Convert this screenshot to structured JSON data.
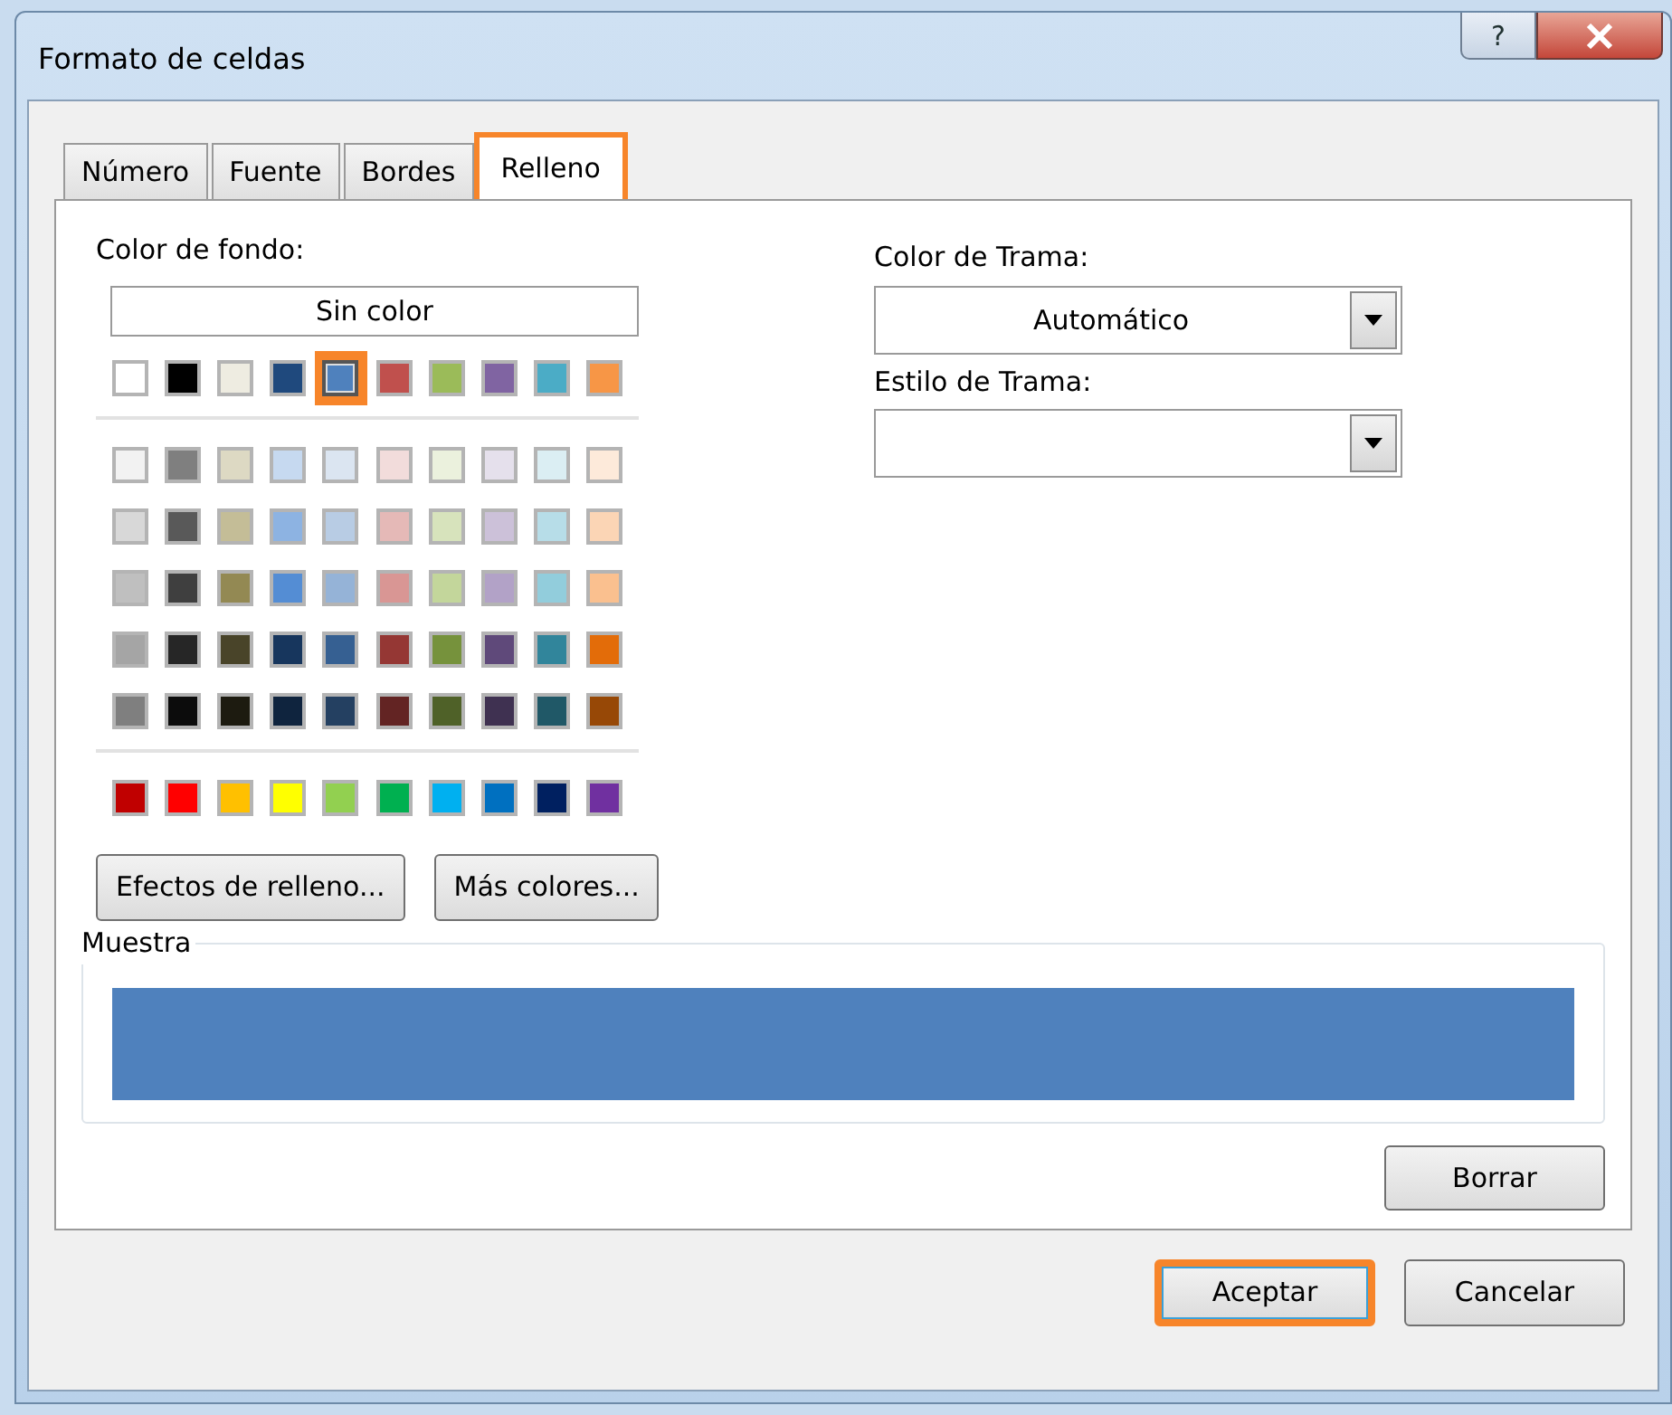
{
  "window": {
    "title": "Formato de celdas",
    "help": "?"
  },
  "tabs": [
    {
      "label": "Número",
      "selected": false
    },
    {
      "label": "Fuente",
      "selected": false
    },
    {
      "label": "Bordes",
      "selected": false
    },
    {
      "label": "Relleno",
      "selected": true,
      "highlighted": true
    }
  ],
  "background_color": {
    "label": "Color de fondo:",
    "no_color_button": "Sin color",
    "palette": [
      {
        "kind": "theme",
        "swatches": [
          {
            "color": "#ffffff",
            "selected": false
          },
          {
            "color": "#000000",
            "selected": false
          },
          {
            "color": "#eeece1",
            "selected": false
          },
          {
            "color": "#1f497d",
            "selected": false
          },
          {
            "color": "#4f81bd",
            "selected": true,
            "highlighted": true
          },
          {
            "color": "#c0504d",
            "selected": false
          },
          {
            "color": "#9bbb59",
            "selected": false
          },
          {
            "color": "#8064a2",
            "selected": false
          },
          {
            "color": "#4bacc6",
            "selected": false
          },
          {
            "color": "#f79646",
            "selected": false
          }
        ]
      },
      {
        "kind": "tint",
        "swatches": [
          {
            "color": "#f2f2f2",
            "selected": false
          },
          {
            "color": "#7f7f7f",
            "selected": false
          },
          {
            "color": "#ddd9c3",
            "selected": false
          },
          {
            "color": "#c6d9f0",
            "selected": false
          },
          {
            "color": "#dbe5f1",
            "selected": false
          },
          {
            "color": "#f2dcdb",
            "selected": false
          },
          {
            "color": "#ebf1dd",
            "selected": false
          },
          {
            "color": "#e5e0ec",
            "selected": false
          },
          {
            "color": "#dbeef3",
            "selected": false
          },
          {
            "color": "#fdeada",
            "selected": false
          }
        ]
      },
      {
        "kind": "tint",
        "swatches": [
          {
            "color": "#d8d8d8",
            "selected": false
          },
          {
            "color": "#595959",
            "selected": false
          },
          {
            "color": "#c4bd97",
            "selected": false
          },
          {
            "color": "#8db3e2",
            "selected": false
          },
          {
            "color": "#b8cce4",
            "selected": false
          },
          {
            "color": "#e5b9b7",
            "selected": false
          },
          {
            "color": "#d7e3bc",
            "selected": false
          },
          {
            "color": "#ccc1d9",
            "selected": false
          },
          {
            "color": "#b7dde8",
            "selected": false
          },
          {
            "color": "#fbd5b5",
            "selected": false
          }
        ]
      },
      {
        "kind": "tint",
        "swatches": [
          {
            "color": "#bfbfbf",
            "selected": false
          },
          {
            "color": "#3f3f3f",
            "selected": false
          },
          {
            "color": "#938953",
            "selected": false
          },
          {
            "color": "#548dd4",
            "selected": false
          },
          {
            "color": "#95b3d7",
            "selected": false
          },
          {
            "color": "#d99694",
            "selected": false
          },
          {
            "color": "#c3d69b",
            "selected": false
          },
          {
            "color": "#b2a2c7",
            "selected": false
          },
          {
            "color": "#92cddc",
            "selected": false
          },
          {
            "color": "#fac08f",
            "selected": false
          }
        ]
      },
      {
        "kind": "tint",
        "swatches": [
          {
            "color": "#a5a5a5",
            "selected": false
          },
          {
            "color": "#262626",
            "selected": false
          },
          {
            "color": "#494429",
            "selected": false
          },
          {
            "color": "#17365d",
            "selected": false
          },
          {
            "color": "#366092",
            "selected": false
          },
          {
            "color": "#953734",
            "selected": false
          },
          {
            "color": "#76923c",
            "selected": false
          },
          {
            "color": "#5f497a",
            "selected": false
          },
          {
            "color": "#31859b",
            "selected": false
          },
          {
            "color": "#e36c09",
            "selected": false
          }
        ]
      },
      {
        "kind": "tint",
        "swatches": [
          {
            "color": "#7f7f7f",
            "selected": false
          },
          {
            "color": "#0c0c0c",
            "selected": false
          },
          {
            "color": "#1d1b10",
            "selected": false
          },
          {
            "color": "#0f243e",
            "selected": false
          },
          {
            "color": "#244061",
            "selected": false
          },
          {
            "color": "#632423",
            "selected": false
          },
          {
            "color": "#4f6128",
            "selected": false
          },
          {
            "color": "#3f3151",
            "selected": false
          },
          {
            "color": "#205867",
            "selected": false
          },
          {
            "color": "#974806",
            "selected": false
          }
        ]
      },
      {
        "kind": "standard",
        "swatches": [
          {
            "color": "#c00000",
            "selected": false
          },
          {
            "color": "#ff0000",
            "selected": false
          },
          {
            "color": "#ffc000",
            "selected": false
          },
          {
            "color": "#ffff00",
            "selected": false
          },
          {
            "color": "#92d050",
            "selected": false
          },
          {
            "color": "#00b050",
            "selected": false
          },
          {
            "color": "#00b0f0",
            "selected": false
          },
          {
            "color": "#0070c0",
            "selected": false
          },
          {
            "color": "#002060",
            "selected": false
          },
          {
            "color": "#7030a0",
            "selected": false
          }
        ]
      }
    ],
    "buttons": [
      "Efectos de relleno...",
      "Más colores..."
    ]
  },
  "pattern_color": {
    "label": "Color de Trama:",
    "value": "Automático"
  },
  "pattern_style": {
    "label": "Estilo de Trama:"
  },
  "sample": {
    "label": "Muestra",
    "color": "#4f81bd"
  },
  "clear_button": "Borrar",
  "footer_buttons": [
    {
      "label": "Aceptar",
      "highlighted": true
    },
    {
      "label": "Cancelar",
      "highlighted": false
    }
  ]
}
